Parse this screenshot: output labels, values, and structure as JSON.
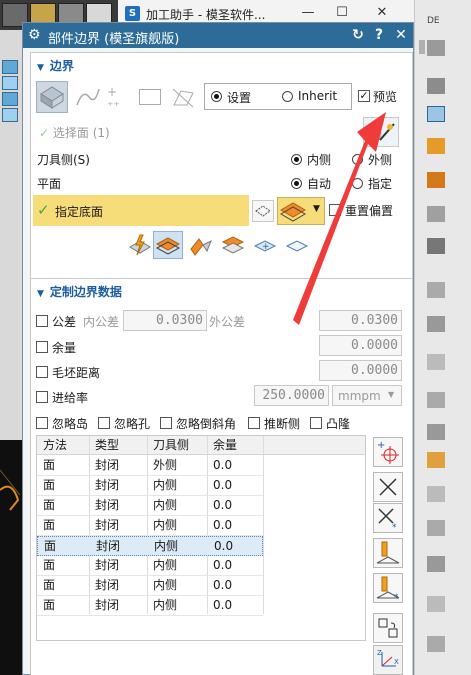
{
  "window": {
    "app_title": "加工助手 - 模圣软件...",
    "app_icon_label": "S",
    "minimize": "—",
    "maximize": "☐",
    "close": "✕"
  },
  "dialog": {
    "title": "部件边界  (模圣旗舰版)",
    "reset": "↻",
    "help": "?",
    "close": "✕"
  },
  "boundary": {
    "section_title": "边界",
    "mode_settings": "设置",
    "mode_inherit": "Inherit",
    "preview": "预览",
    "select_face": "选择面 (1)",
    "tool_side_label": "刀具侧(S)",
    "tool_side_inside": "内侧",
    "tool_side_outside": "外侧",
    "plane_label": "平面",
    "plane_auto": "自动",
    "plane_specify": "指定",
    "specify_floor": "指定底面",
    "reset_offset": "重置偏置"
  },
  "custom": {
    "section_title": "定制边界数据",
    "tolerance": "公差",
    "inner_tol_label": "内公差",
    "inner_tol_value": "0.0300",
    "outer_tol_label": "外公差",
    "outer_tol_value": "0.0300",
    "allowance": "余量",
    "allowance_value": "0.0000",
    "blank_distance": "毛坯距离",
    "blank_distance_value": "0.0000",
    "feed_rate": "进给率",
    "feed_rate_value": "250.0000",
    "feed_unit": "mmpm",
    "options": [
      "忽略岛",
      "忽略孔",
      "忽略倒斜角",
      "推断侧",
      "凸隆"
    ]
  },
  "table": {
    "columns": [
      "方法",
      "类型",
      "刀具侧",
      "余量"
    ],
    "rows": [
      [
        "面",
        "封闭",
        "外侧",
        "0.0"
      ],
      [
        "面",
        "封闭",
        "内侧",
        "0.0"
      ],
      [
        "面",
        "封闭",
        "内侧",
        "0.0"
      ],
      [
        "面",
        "封闭",
        "内侧",
        "0.0"
      ],
      [
        "面",
        "封闭",
        "内侧",
        "0.0"
      ],
      [
        "面",
        "封闭",
        "内侧",
        "0.0"
      ],
      [
        "面",
        "封闭",
        "内侧",
        "0.0"
      ],
      [
        "面",
        "封闭",
        "内侧",
        "0.0"
      ]
    ],
    "selected_row": 4
  },
  "colors": {
    "header": "#2d6c99",
    "section_title": "#1d5ea0",
    "floor_highlight": "#f7dc7a",
    "check_green": "#3fae3f",
    "arrow_red": "#f03b3b"
  },
  "right_toolbar": {
    "label": "DE"
  }
}
